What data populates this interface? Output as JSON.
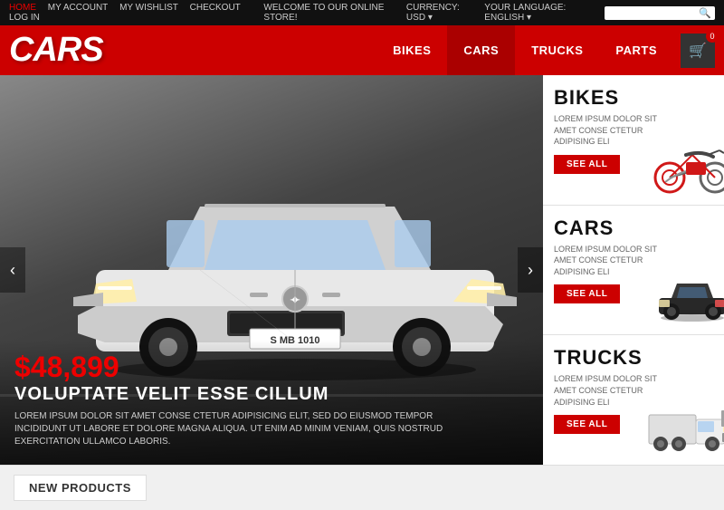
{
  "topbar": {
    "links": [
      {
        "label": "HOME",
        "active": true
      },
      {
        "label": "MY ACCOUNT",
        "active": false
      },
      {
        "label": "MY WISHLIST",
        "active": false
      },
      {
        "label": "CHECKOUT",
        "active": false
      },
      {
        "label": "LOG IN",
        "active": false
      }
    ],
    "welcome": "WELCOME TO OUR ONLINE STORE!",
    "currency_label": "CURRENCY: USD",
    "language_label": "YOUR LANGUAGE: ENGLISH",
    "search_placeholder": ""
  },
  "header": {
    "logo": "CARS",
    "nav": [
      {
        "label": "BIKES",
        "active": false
      },
      {
        "label": "CARS",
        "active": true
      },
      {
        "label": "TRUCKS",
        "active": false
      },
      {
        "label": "PARTS",
        "active": false
      }
    ],
    "cart_count": "0"
  },
  "hero": {
    "price": "$48,899",
    "title": "VOLUPTATE VELIT ESSE CILLUM",
    "description": "LOREM IPSUM DOLOR SIT AMET CONSE CTETUR ADIPISICING ELIT, SED DO EIUSMOD TEMPOR INCIDIDUNT UT LABORE ET DOLORE MAGNA ALIQUA. UT ENIM AD MINIM VENIAM, QUIS NOSTRUD EXERCITATION ULLAMCO LABORIS."
  },
  "sidebar": [
    {
      "title": "BIKES",
      "desc": "LOREM IPSUM DOLOR SIT\nAMET CONSE CTETUR\nADIPISING ELI",
      "btn": "SEE ALL",
      "type": "bike"
    },
    {
      "title": "CARS",
      "desc": "LOREM IPSUM DOLOR SIT\nAMET CONSE CTETUR\nADIPISING ELI",
      "btn": "SEE ALL",
      "type": "car"
    },
    {
      "title": "TRUCKS",
      "desc": "LOREM IPSUM DOLOR SIT\nAMET CONSE CTETUR\nADIPISING ELI",
      "btn": "SEE ALL",
      "type": "truck"
    }
  ],
  "bottom": {
    "new_products_label": "NEW PRODUCTS"
  }
}
